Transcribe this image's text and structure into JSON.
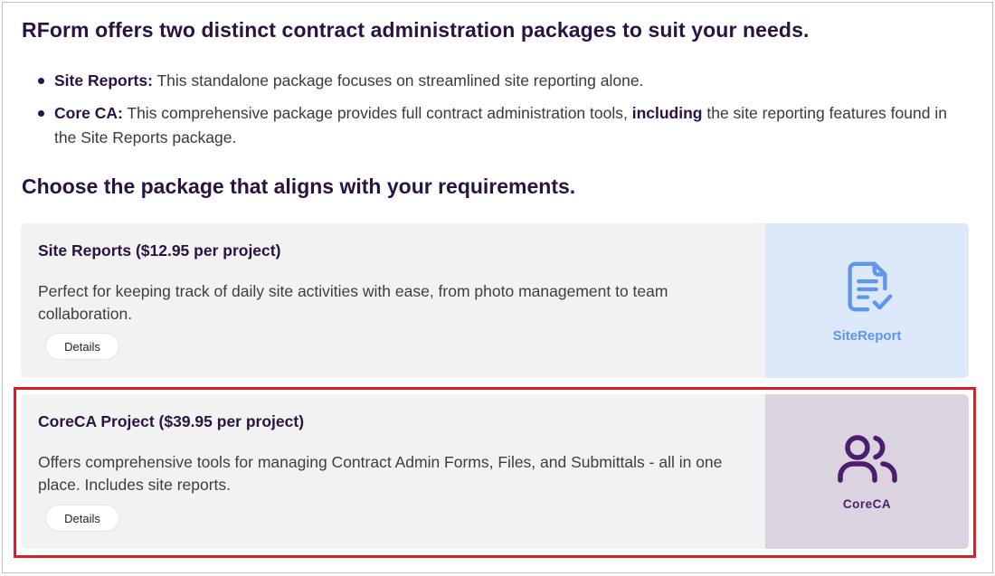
{
  "intro": {
    "heading": "RForm offers two distinct contract administration packages to suit your needs.",
    "bullets": [
      {
        "label": "Site Reports:",
        "text": " This standalone package focuses on streamlined site reporting alone."
      },
      {
        "label": "Core CA:",
        "text_before": " This comprehensive package provides full contract administration tools, ",
        "emphasis": "including",
        "text_after": " the site reporting features found in the Site Reports package."
      }
    ]
  },
  "choose_heading": "Choose the package that aligns with your requirements.",
  "packages": [
    {
      "title": "Site Reports ($12.95 per project)",
      "description": "Perfect for keeping track of daily site activities with ease, from photo management to team collaboration.",
      "details_label": "Details",
      "logo_label": "SiteReport",
      "logo_icon": "document-check-icon",
      "accent": "#5f95ea"
    },
    {
      "title": "CoreCA Project ($39.95 per project)",
      "description": "Offers comprehensive tools for managing Contract Admin Forms, Files, and Submittals - all in one place. Includes site reports.",
      "details_label": "Details",
      "logo_label": "CoreCA",
      "logo_icon": "users-icon",
      "accent": "#4a1d6e"
    }
  ],
  "colors": {
    "heading": "#2a1342",
    "highlight_border": "#d61f26"
  }
}
